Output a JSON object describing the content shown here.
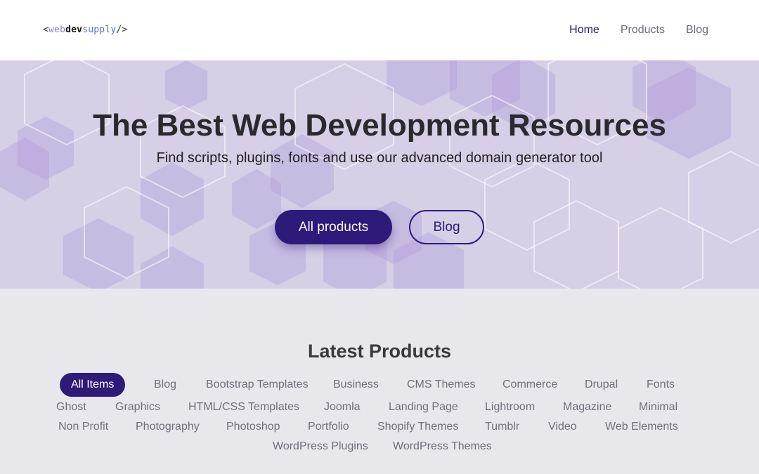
{
  "header": {
    "logo": {
      "open": "<",
      "web": "web",
      "dev": "dev",
      "supply": "supply",
      "close": "/>"
    },
    "nav": [
      {
        "label": "Home",
        "active": true
      },
      {
        "label": "Products",
        "active": false
      },
      {
        "label": "Blog",
        "active": false
      }
    ]
  },
  "hero": {
    "title": "The Best Web Development Resources",
    "subtitle": "Find scripts, plugins, fonts and use our advanced domain generator tool",
    "primary_button": "All products",
    "secondary_button": "Blog"
  },
  "products": {
    "title": "Latest Products",
    "filters": [
      "All Items",
      "Blog",
      "Bootstrap Templates",
      "Business",
      "CMS Themes",
      "Commerce",
      "Drupal",
      "Fonts",
      "Ghost",
      "Graphics",
      "HTML/CSS Templates",
      "Joomla",
      "Landing Page",
      "Lightroom",
      "Magazine",
      "Minimal",
      "Non Profit",
      "Photography",
      "Photoshop",
      "Portfolio",
      "Shopify Themes",
      "Tumblr",
      "Video",
      "Web Elements",
      "WordPress Plugins",
      "WordPress Themes"
    ],
    "active_filter": "All Items"
  },
  "colors": {
    "accent": "#2e1a78",
    "hero_bg": "#d6cfe6",
    "page_bg": "#e8e8ec"
  }
}
